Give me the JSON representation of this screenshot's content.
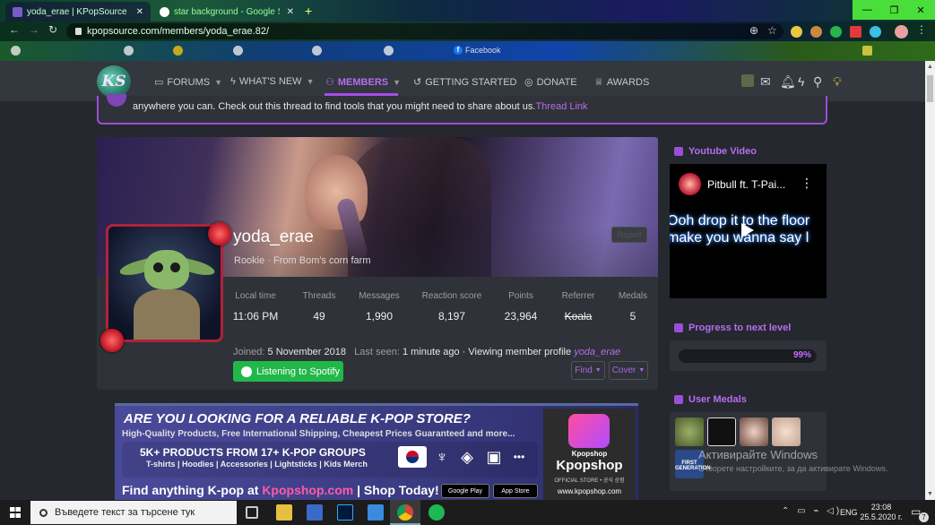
{
  "browser": {
    "tabs": [
      {
        "title": "yoda_erae | KPopSource - Intern",
        "active": true
      },
      {
        "title": "star background - Google Search",
        "active": false
      }
    ],
    "new_tab": "+",
    "url": "kpopsource.com/members/yoda_erae.82/",
    "bookmark_label": "Facebook",
    "window_controls": [
      "minimize",
      "maximize",
      "close"
    ]
  },
  "site": {
    "logo_text": "KS",
    "nav": [
      {
        "label": "FORUMS",
        "icon": "chat-icon",
        "dropdown": true
      },
      {
        "label": "WHAT'S NEW",
        "icon": "bolt-icon",
        "dropdown": true
      },
      {
        "label": "MEMBERS",
        "icon": "users-icon",
        "dropdown": true,
        "selected": true
      },
      {
        "label": "GETTING STARTED",
        "icon": "history-icon",
        "dropdown": false
      },
      {
        "label": "DONATE",
        "icon": "coin-icon",
        "dropdown": false
      },
      {
        "label": "AWARDS",
        "icon": "trophy-icon",
        "dropdown": false
      }
    ],
    "accent": "#b76cf0",
    "notice_text": "anywhere you can. Check out this thread to find tools that you might need to share about us.",
    "notice_link": "Thread Link"
  },
  "profile": {
    "username": "yoda_erae",
    "title": "Rookie",
    "location": "From Bom's corn farm",
    "report": "Report",
    "stats": [
      {
        "label": "Local time",
        "value": "11:06 PM"
      },
      {
        "label": "Threads",
        "value": "49"
      },
      {
        "label": "Messages",
        "value": "1,990"
      },
      {
        "label": "Reaction score",
        "value": "8,197"
      },
      {
        "label": "Points",
        "value": "23,964"
      },
      {
        "label": "Referrer",
        "value": "Koala"
      },
      {
        "label": "Medals",
        "value": "5"
      }
    ],
    "joined_label": "Joined:",
    "joined_value": "5 November 2018",
    "last_seen_label": "Last seen:",
    "last_seen_value": "1 minute ago · Viewing member profile",
    "last_seen_user": "yoda_erae",
    "spotify_label": "Listening to Spotify",
    "find_label": "Find",
    "cover_label": "Cover"
  },
  "ad": {
    "headline": "ARE YOU LOOKING FOR A RELIABLE K-POP STORE?",
    "subline": "High-Quality Products, Free International Shipping, Cheapest Prices Guaranteed and more...",
    "products_title": "5K+ PRODUCTS FROM 17+ K-POP GROUPS",
    "products_list": "T-shirts | Hoodies | Accessories | Lightsticks | Kids Merch",
    "cta_prefix": "Find anything K-pop at ",
    "cta_site": "Kpopshop.com",
    "cta_suffix": " | Shop Today!",
    "google_play": "Google Play",
    "app_store": "App Store",
    "brand_small": "Kpopshop",
    "brand_big": "Kpopshop",
    "brand_tag": "OFFICIAL STORE • 공식 상점",
    "brand_url": "www.kpopshop.com"
  },
  "sidebar": {
    "youtube_title": "Youtube Video",
    "video_title": "Pitbull ft. T-Pai...",
    "lyric_line1": "Ooh drop it to the floor",
    "lyric_line2": "make you wanna say l",
    "progress_title": "Progress to next level",
    "progress_text": "99%",
    "progress_value": 0.99,
    "medals_title": "User Medals",
    "medal_5_text": "FIRST GENERATION"
  },
  "windows_activation": {
    "title": "Активирайте Windows",
    "subtitle": "Отворете настройките, за да активирате Windows."
  },
  "taskbar": {
    "search_placeholder": "Въведете текст за търсене тук",
    "language": "ENG",
    "time": "23:08",
    "date": "25.5.2020 г.",
    "notification_count": "7"
  }
}
